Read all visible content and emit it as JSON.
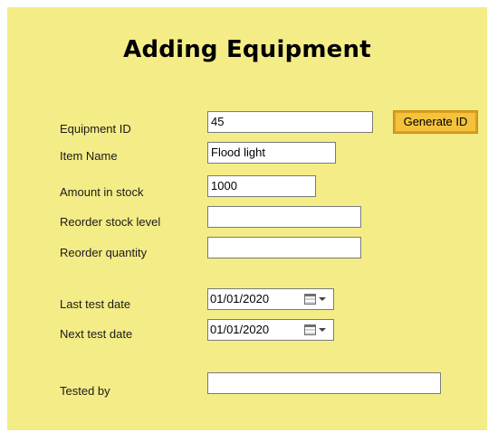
{
  "form": {
    "title": "Adding Equipment",
    "fields": {
      "equipment_id": {
        "label": "Equipment ID",
        "value": "45"
      },
      "item_name": {
        "label": "Item Name",
        "value": "Flood light"
      },
      "amount_in_stock": {
        "label": "Amount in stock",
        "value": "1000"
      },
      "reorder_stock_level": {
        "label": "Reorder stock level",
        "value": ""
      },
      "reorder_quantity": {
        "label": "Reorder quantity",
        "value": ""
      },
      "last_test_date": {
        "label": "Last test date",
        "value": "01/01/2020"
      },
      "next_test_date": {
        "label": "Next test date",
        "value": "01/01/2020"
      },
      "tested_by": {
        "label": "Tested by",
        "value": ""
      }
    },
    "generate_id_label": "Generate ID"
  },
  "colors": {
    "panel_background": "#f4ec86",
    "button_background": "#f4c23c",
    "button_border": "#dba020"
  },
  "icons": {
    "date_picker": "calendar-icon",
    "dropdown": "dropdown-arrow-icon"
  }
}
